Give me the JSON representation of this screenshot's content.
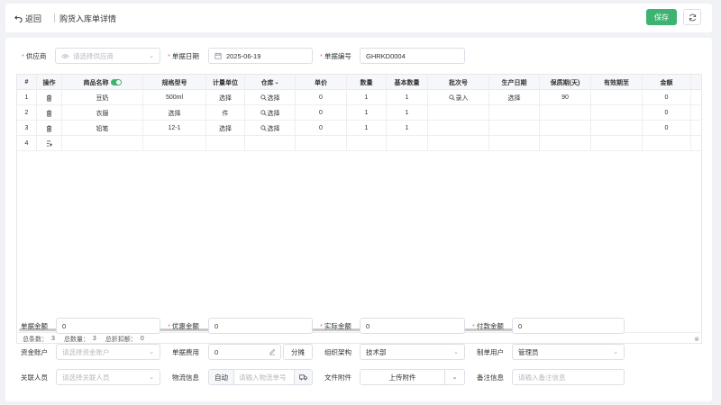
{
  "header": {
    "back_label": "返回",
    "title": "购货入库单详情",
    "save_label": "保存"
  },
  "form_top": {
    "supplier_label": "供应商",
    "supplier_placeholder": "请选择供应商",
    "date_label": "单据日期",
    "date_value": "2025-06-19",
    "number_label": "单据编号",
    "number_value": "GHRKD0004"
  },
  "table": {
    "headers": {
      "index": "#",
      "op": "操作",
      "name": "商品名称",
      "spec": "规格型号",
      "unit": "计量单位",
      "warehouse": "仓库",
      "price": "单价",
      "qty": "数量",
      "base_qty": "基本数量",
      "batch": "批次号",
      "prod_date": "生产日期",
      "shelf": "保质期(天)",
      "expiry": "有效期至",
      "amount": "金额"
    },
    "rows": [
      {
        "index": "1",
        "name": "豆奶",
        "spec": "500ml",
        "unit": "选择",
        "warehouse": "选择",
        "price": "0",
        "qty": "1",
        "base_qty": "1",
        "batch": "录入",
        "prod_date": "选择",
        "shelf": "90",
        "expiry": "",
        "amount": "0"
      },
      {
        "index": "2",
        "name": "衣服",
        "spec": "选择",
        "unit": "件",
        "warehouse": "选择",
        "price": "0",
        "qty": "1",
        "base_qty": "1",
        "batch": "",
        "prod_date": "",
        "shelf": "",
        "expiry": "",
        "amount": "0"
      },
      {
        "index": "3",
        "name": "铅笔",
        "spec": "12-1",
        "unit": "选择",
        "warehouse": "选择",
        "price": "0",
        "qty": "1",
        "base_qty": "1",
        "batch": "",
        "prod_date": "",
        "shelf": "",
        "expiry": "",
        "amount": "0"
      }
    ],
    "new_row_index": "4",
    "summary": {
      "count_label": "总条数：",
      "count_value": "3",
      "qty_label": "总数量：",
      "qty_value": "3",
      "discount_label": "总折扣额：",
      "discount_value": "0"
    }
  },
  "form_bottom": {
    "doc_amount_label": "单据金额",
    "doc_amount_value": "0",
    "discount_label": "优惠金额",
    "discount_value": "0",
    "actual_label": "实际金额",
    "actual_value": "0",
    "paid_label": "付款金额",
    "paid_value": "0",
    "account_label": "资金账户",
    "account_placeholder": "请选择资金账户",
    "fee_label": "单据费用",
    "fee_value": "0",
    "split_label": "分摊",
    "org_label": "组织架构",
    "org_value": "技术部",
    "creator_label": "制单用户",
    "creator_value": "管理员",
    "related_label": "关联人员",
    "related_placeholder": "请选择关联人员",
    "logistics_label": "物流信息",
    "logistics_auto": "自动",
    "logistics_placeholder": "请输入物流单号",
    "file_label": "文件附件",
    "upload_label": "上传附件",
    "remark_label": "备注信息",
    "remark_placeholder": "请输入备注信息"
  },
  "icons": {
    "back": "undo-arrow-icon",
    "refresh": "refresh-icon",
    "calendar": "calendar-icon",
    "delete": "trash-icon",
    "search": "search-icon",
    "eye": "eye-icon",
    "truck": "truck-icon",
    "edit": "edit-icon"
  },
  "colors": {
    "primary": "#3cb371",
    "required": "#f56c6c"
  }
}
